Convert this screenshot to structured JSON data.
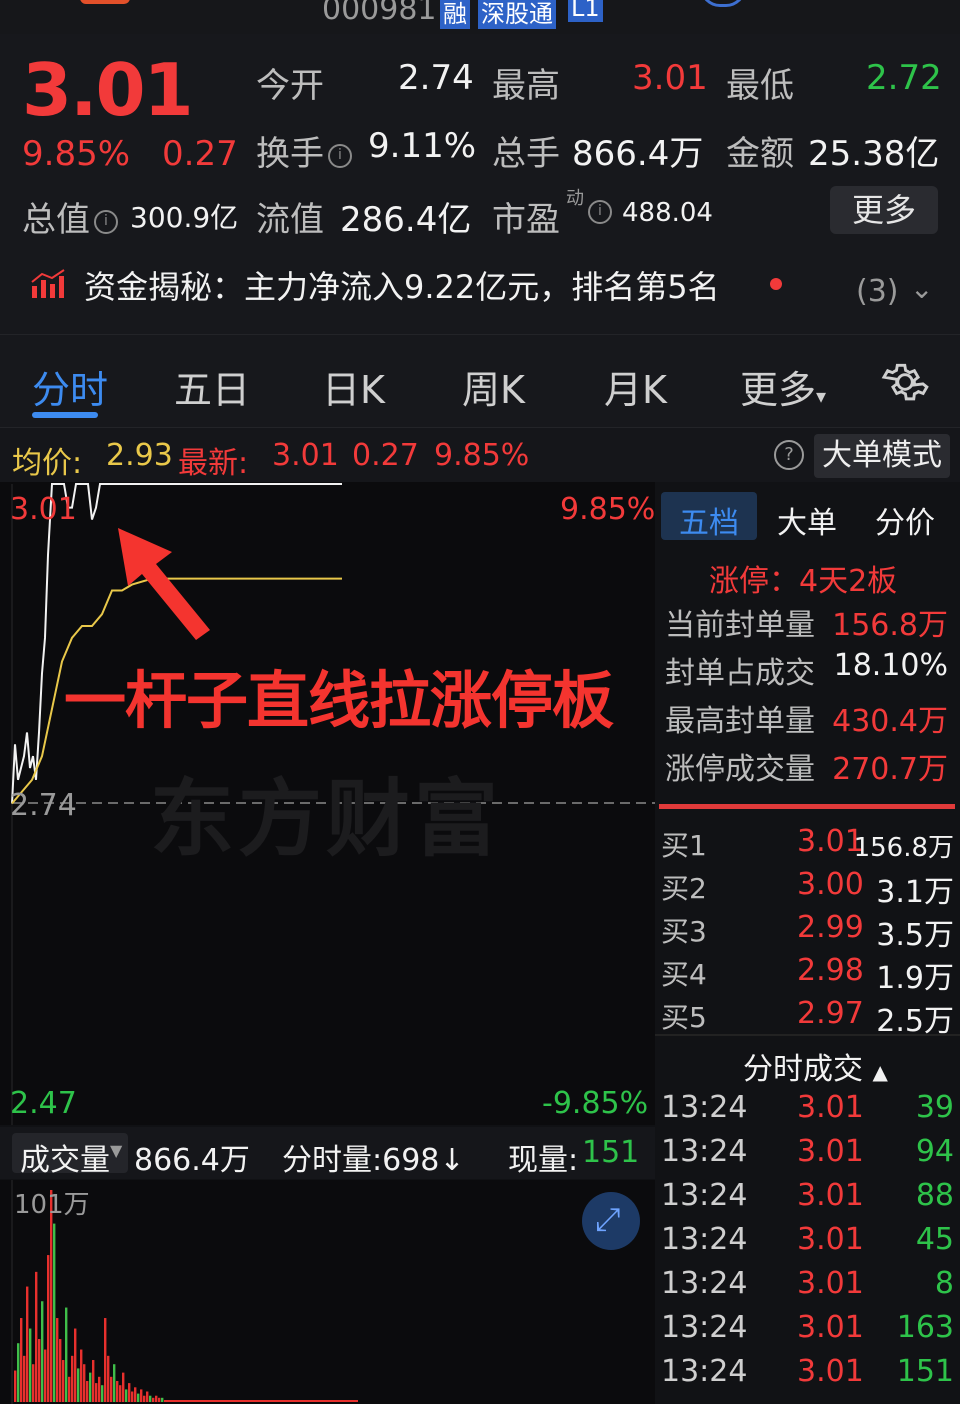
{
  "header": {
    "code": "000981",
    "badges": [
      "融",
      "深股通",
      "L1"
    ]
  },
  "quote": {
    "price": "3.01",
    "change_pct": "9.85%",
    "change": "0.27",
    "open_label": "今开",
    "open": "2.74",
    "high_label": "最高",
    "high": "3.01",
    "low_label": "最低",
    "low": "2.72",
    "turnover_label": "换手",
    "turnover": "9.11%",
    "volume_label": "总手",
    "volume": "866.4万",
    "amount_label": "金额",
    "amount": "25.38亿",
    "mktcap_label": "总值",
    "mktcap": "300.9亿",
    "float_label": "流值",
    "float": "286.4亿",
    "pe_label": "市盈",
    "pe_sup": "动",
    "pe": "488.04",
    "more_label": "更多"
  },
  "capital": {
    "text": "资金揭秘：主力净流入9.22亿元，排名第5名",
    "count": "(3)"
  },
  "tabs": [
    "分时",
    "五日",
    "日K",
    "周K",
    "月K",
    "更多"
  ],
  "infobar": {
    "avg_label": "均价:",
    "avg": "2.93",
    "latest_label": "最新:",
    "latest": "3.01",
    "chg": "0.27",
    "pct": "9.85%",
    "mode_label": "大单模式"
  },
  "chart": {
    "price_top": "3.01",
    "pct_top": "9.85%",
    "price_mid": "2.74",
    "price_bottom": "2.47",
    "pct_bottom": "-9.85%",
    "annotation": "一杆子直线拉涨停板",
    "watermark": "东方财富"
  },
  "chart_data": {
    "type": "line",
    "ylim": [
      2.47,
      3.01
    ],
    "series": [
      {
        "name": "",
        "color": "#f2f2f2",
        "x": [
          0,
          3,
          6,
          9,
          12,
          15,
          18,
          21,
          24,
          27,
          30,
          33,
          36,
          40,
          44,
          48,
          52,
          56,
          60,
          64,
          70,
          76,
          80,
          84,
          88,
          92,
          96,
          100,
          130,
          200,
          260,
          330
        ],
        "values": [
          2.74,
          2.79,
          2.76,
          2.77,
          2.78,
          2.8,
          2.77,
          2.78,
          2.76,
          2.8,
          2.85,
          2.88,
          2.95,
          3.01,
          3.01,
          3.01,
          3.01,
          2.99,
          2.99,
          3.01,
          3.01,
          3.01,
          2.98,
          2.99,
          3.01,
          3.01,
          3.01,
          3.01,
          3.01,
          3.01,
          3.01,
          3.01
        ]
      },
      {
        "name": "",
        "color": "#e9c84a",
        "x": [
          0,
          10,
          20,
          30,
          40,
          50,
          60,
          70,
          80,
          90,
          100,
          110,
          120,
          140,
          160,
          180,
          200,
          230,
          260,
          300,
          330
        ],
        "values": [
          2.74,
          2.75,
          2.76,
          2.78,
          2.82,
          2.86,
          2.88,
          2.89,
          2.89,
          2.9,
          2.92,
          2.92,
          2.925,
          2.93,
          2.93,
          2.93,
          2.93,
          2.93,
          2.93,
          2.93,
          2.93
        ]
      }
    ]
  },
  "volume": {
    "label": "成交量",
    "total": "866.4万",
    "bar_label": "分时量:698↓",
    "now_label": "现量:",
    "now": "151",
    "scale": "101万"
  },
  "volume_data": {
    "max": 101,
    "values": [
      15,
      28,
      40,
      22,
      55,
      35,
      18,
      62,
      30,
      48,
      25,
      70,
      101,
      85,
      40,
      30,
      20,
      45,
      12,
      22,
      35,
      16,
      25,
      18,
      10,
      14,
      20,
      9,
      12,
      8,
      40,
      22,
      12,
      18,
      10,
      8,
      14,
      6,
      9,
      5,
      7,
      4,
      6,
      3,
      5,
      3,
      2,
      3,
      2,
      2
    ]
  },
  "panel": {
    "tabs": [
      "五档",
      "大单",
      "分价"
    ],
    "limit": "涨停：4天2板",
    "stats": [
      {
        "label": "当前封单量",
        "value": "156.8万"
      },
      {
        "label": "封单占成交",
        "value": "18.10%"
      },
      {
        "label": "最高封单量",
        "value": "430.4万"
      },
      {
        "label": "涨停成交量",
        "value": "270.7万"
      }
    ],
    "bids": [
      {
        "label": "买1",
        "price": "3.01",
        "vol": "156.8万"
      },
      {
        "label": "买2",
        "price": "3.00",
        "vol": "3.1万"
      },
      {
        "label": "买3",
        "price": "2.99",
        "vol": "3.5万"
      },
      {
        "label": "买4",
        "price": "2.98",
        "vol": "1.9万"
      },
      {
        "label": "买5",
        "price": "2.97",
        "vol": "2.5万"
      }
    ],
    "ticks_title": "分时成交",
    "ticks": [
      {
        "time": "13:24",
        "price": "3.01",
        "vol": "39"
      },
      {
        "time": "13:24",
        "price": "3.01",
        "vol": "94"
      },
      {
        "time": "13:24",
        "price": "3.01",
        "vol": "88"
      },
      {
        "time": "13:24",
        "price": "3.01",
        "vol": "45"
      },
      {
        "time": "13:24",
        "price": "3.01",
        "vol": "8"
      },
      {
        "time": "13:24",
        "price": "3.01",
        "vol": "163"
      },
      {
        "time": "13:24",
        "price": "3.01",
        "vol": "151"
      }
    ]
  }
}
